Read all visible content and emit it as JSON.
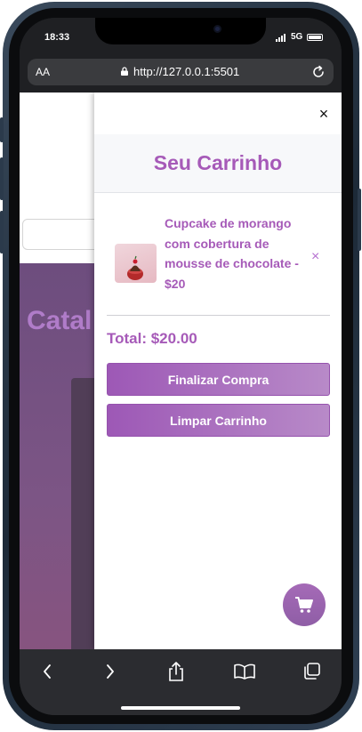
{
  "status_bar": {
    "time": "18:33",
    "network": "5G"
  },
  "browser": {
    "text_size_label": "AA",
    "url": "http://127.0.0.1:5501"
  },
  "background_page": {
    "title_partial": "Catal"
  },
  "cart": {
    "close_symbol": "×",
    "title": "Seu Carrinho",
    "items": [
      {
        "description": "Cupcake de morango com cobertura de mousse de chocolate - $20",
        "remove_symbol": "×"
      }
    ],
    "total_label": "Total: $20.00",
    "checkout_label": "Finalizar Compra",
    "clear_label": "Limpar Carrinho"
  },
  "icons": {
    "lock": "lock-icon",
    "reload": "reload-icon",
    "cart": "cart-icon",
    "back": "back-icon",
    "forward": "forward-icon",
    "share": "share-icon",
    "bookmarks": "bookmarks-icon",
    "tabs": "tabs-icon"
  },
  "colors": {
    "accent": "#a65ab8",
    "button_start": "#9d58b6",
    "button_end": "#b88ac8",
    "fab": "#a56ab7"
  }
}
